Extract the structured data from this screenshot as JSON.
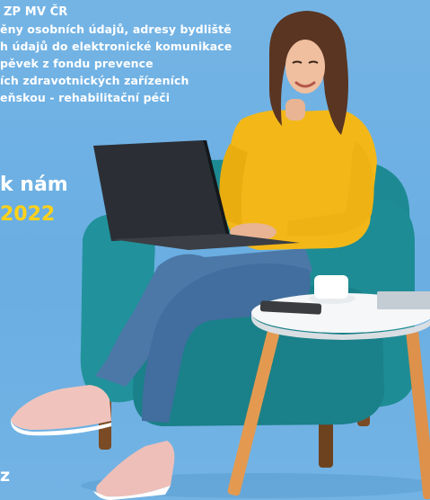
{
  "benefits": {
    "lines": [
      "ZP MV ČR",
      "ěny osobních údajů, adresy bydliště",
      "h údajů do elektronické komunikace",
      "pěvek z fondu prevence",
      "ích zdravotnických zařízeních",
      "eňskou - rehabilitační péči"
    ]
  },
  "headline": {
    "text": "k nám",
    "year": "2022"
  },
  "corner": {
    "text": "z"
  },
  "colors": {
    "background": "#6fb0e2",
    "armchair": "#1f8f97",
    "sweater": "#f2b816",
    "jeans": "#4a78a8",
    "sneakers": "#f1c6c0",
    "table_top": "#f4f6f7",
    "table_legs": "#e49a52",
    "laptop": "#2a2d33",
    "headline_year": "#ffd11a"
  }
}
